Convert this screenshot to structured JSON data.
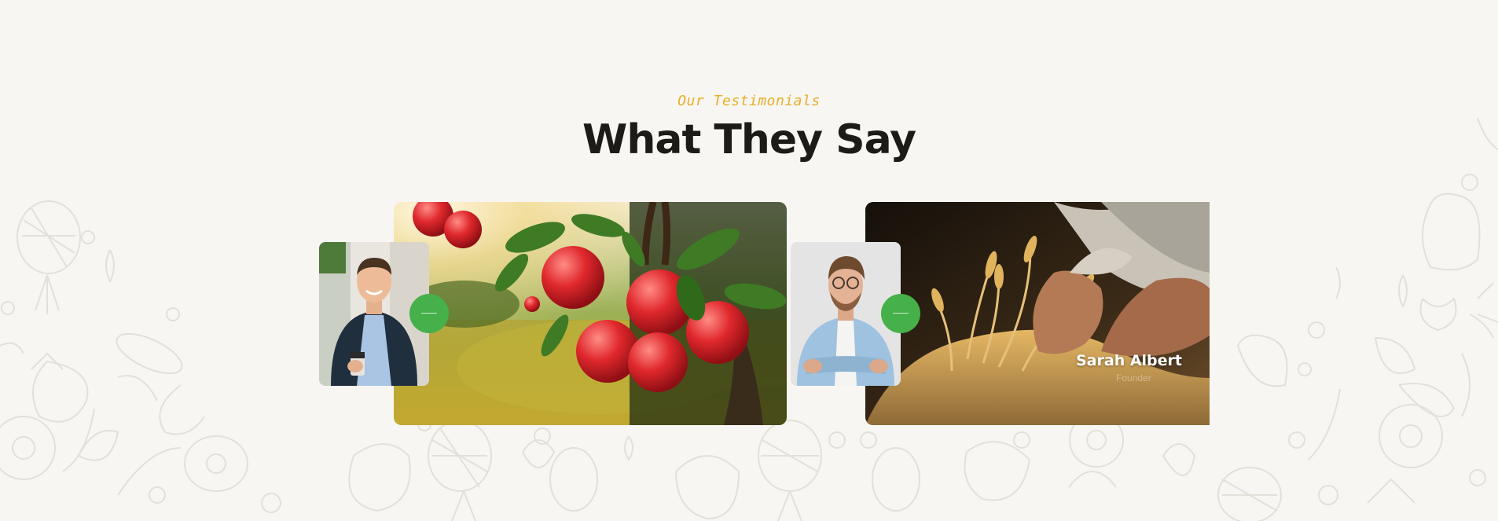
{
  "section": {
    "eyebrow": "Our Testimonials",
    "title": "What They Say"
  },
  "testimonials": [
    {
      "image": "apple-orchard-photo",
      "avatar": "smiling-man-coffee-portrait",
      "name": "",
      "role": ""
    },
    {
      "image": "wheat-hands-photo",
      "avatar": "man-glasses-portrait",
      "name": "Sarah Albert",
      "role": "Founder"
    }
  ],
  "colors": {
    "background": "#f8f6f2",
    "accent": "#e6b02c",
    "title": "#1d1b17",
    "dot": "#46b04a"
  }
}
